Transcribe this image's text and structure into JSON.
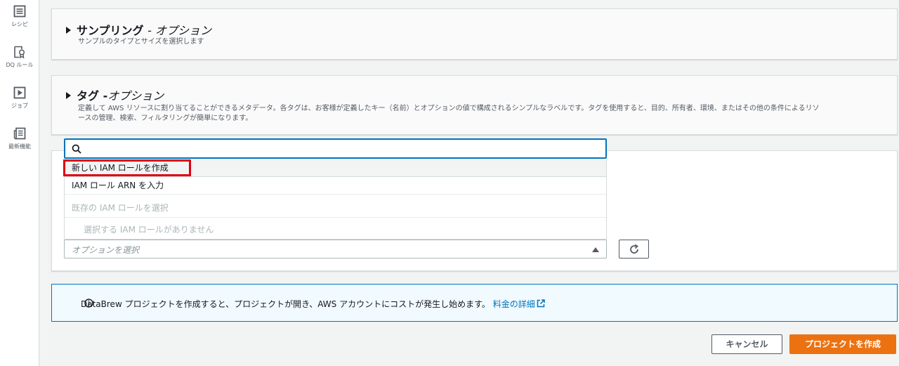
{
  "nav": {
    "items": [
      {
        "label": "レシピ",
        "icon": "list-icon"
      },
      {
        "label": "DQ ルール",
        "icon": "ribbon-icon"
      },
      {
        "label": "ジョブ",
        "icon": "play-icon"
      },
      {
        "label": "最新機能",
        "icon": "newspaper-icon"
      }
    ]
  },
  "sampling": {
    "title": "サンプリング",
    "optional": "- オプション",
    "description": "サンプルのタイプとサイズを選択します"
  },
  "tags": {
    "title": "タグ -",
    "optional": "オプション",
    "description_line1": "定義して AWS リソースに割り当てることができるメタデータ。各タグは、お客様が定義したキー（名前）とオプションの値で構成されるシンプルなラベルです。タグを使用すると、目的、所有者、環境、またはその他の条件によるリソ",
    "description_line2": "ースの管理、検索、フィルタリングが簡単になります。"
  },
  "role_dropdown": {
    "search_value": "",
    "options": [
      {
        "label": "新しい IAM ロールを作成",
        "highlighted": true
      },
      {
        "label": "IAM ロール ARN を入力"
      }
    ],
    "group_label": "既存の IAM ロールを選択",
    "empty_label": "選択する IAM ロールがありません",
    "select_placeholder": "オプションを選択"
  },
  "info": {
    "text": "DataBrew プロジェクトを作成すると、プロジェクトが開き、AWS アカウントにコストが発生し始めます。",
    "link_text": "料金の詳細"
  },
  "footer": {
    "cancel_label": "キャンセル",
    "create_label": "プロジェクトを作成"
  },
  "colors": {
    "primary_button": "#ec7211",
    "link": "#0073bb",
    "highlight_border": "#e1000f"
  }
}
